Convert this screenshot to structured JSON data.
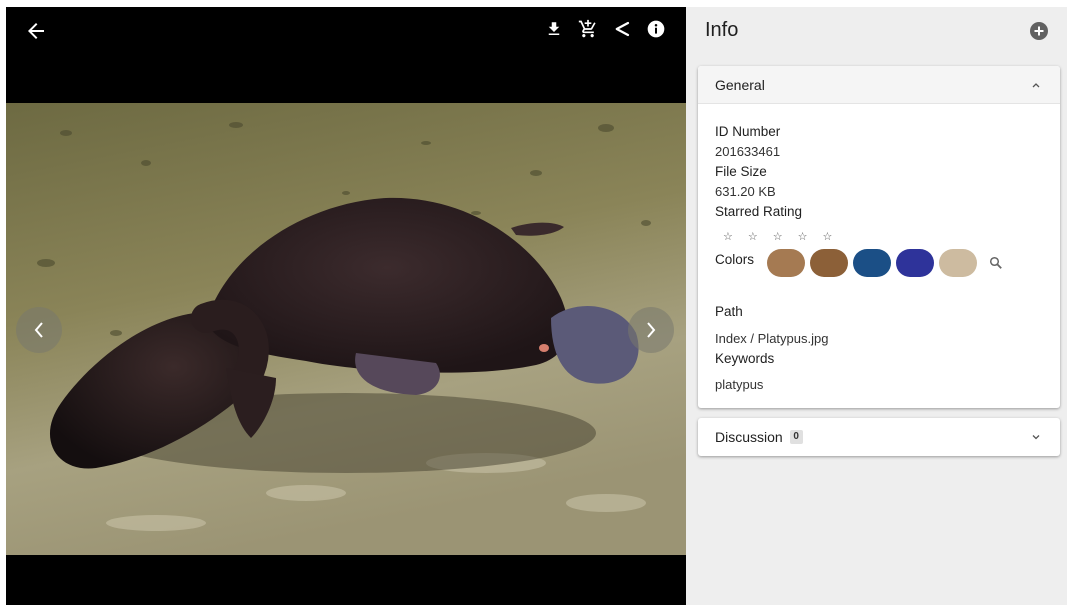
{
  "viewer": {
    "toolbar": {
      "icons": [
        "back-arrow-icon",
        "download-icon",
        "add-to-cart-icon",
        "share-icon",
        "info-icon"
      ]
    }
  },
  "panel": {
    "title": "Info",
    "general": {
      "header": "General",
      "id_label": "ID Number",
      "id_value": "201633461",
      "size_label": "File Size",
      "size_value": "631.20 KB",
      "rating_label": "Starred Rating",
      "stars": [
        "☆",
        "☆",
        "☆",
        "☆",
        "☆"
      ],
      "colors_label": "Colors",
      "colors": [
        "#a57a52",
        "#8c6038",
        "#1b4f86",
        "#2e339a",
        "#cdbba0"
      ],
      "path_label": "Path",
      "path_value": "Index / Platypus.jpg",
      "keywords_label": "Keywords",
      "keywords_value": "platypus"
    },
    "discussion": {
      "header": "Discussion",
      "count": "0"
    }
  }
}
